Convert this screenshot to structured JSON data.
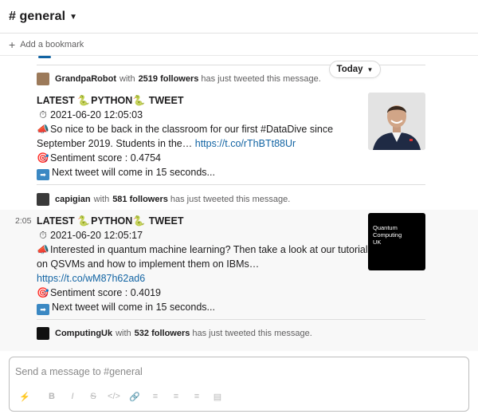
{
  "channel": {
    "name": "# general"
  },
  "bookmark": {
    "add_label": "Add a bookmark"
  },
  "date_divider": {
    "label": "Today"
  },
  "context": [
    {
      "user": "GrandpaRobot",
      "followers": "2519 followers",
      "with": "with",
      "suffix": "has just tweeted this message."
    },
    {
      "user": "capigian",
      "followers": "581 followers",
      "with": "with",
      "suffix": "has just tweeted this message."
    },
    {
      "user": "ComputingUk",
      "followers": "532 followers",
      "with": "with",
      "suffix": "has just tweeted this message."
    }
  ],
  "messages": [
    {
      "time": "",
      "title_a": "LATEST ",
      "title_b": "PYTHON",
      "title_c": " TWEET",
      "timestamp": "2021-06-20 12:05:03",
      "text1": "So nice to be back in the classroom for our first #DataDive since",
      "text2": "September 2019.  Students in the… ",
      "link": "https://t.co/rThBTt88Ur",
      "sentiment": "Sentiment score : 0.4754",
      "next": "Next tweet will come in 15 seconds..."
    },
    {
      "time": "2:05",
      "title_a": "LATEST ",
      "title_b": "PYTHON",
      "title_c": " TWEET",
      "timestamp": "2021-06-20 12:05:17",
      "text1": "Interested in quantum machine learning? Then take a look at our tutorial",
      "text2": "on QSVMs and how to implement them on IBMs…",
      "link": "https://t.co/wM87h62ad6",
      "sentiment": "Sentiment score : 0.4019",
      "next": "Next tweet will come in 15 seconds...",
      "thumb_text": [
        "Quantum",
        "Computing",
        "UK"
      ]
    }
  ],
  "composer": {
    "placeholder": "Send a message to #general",
    "soon_badge": "SOON"
  },
  "icons": {
    "snake": "snake-emoji",
    "timer": "stopwatch-emoji",
    "megaphone": "megaphone-emoji",
    "target": "direct-hit-emoji",
    "soon": "soon-arrow-emoji"
  },
  "colors": {
    "link": "#1264a3",
    "soon_badge": "#3b88c3"
  }
}
